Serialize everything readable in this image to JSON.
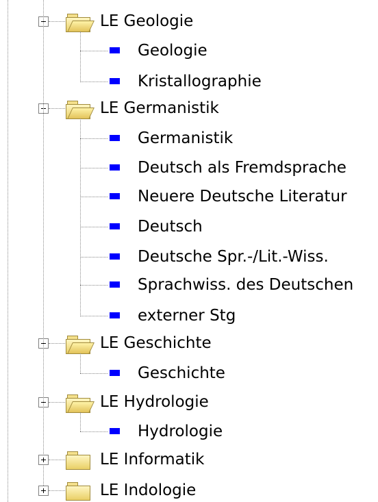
{
  "tree": {
    "nodes": [
      {
        "label": "LE Geologie",
        "expanded": true,
        "icon": "folder-open-icon",
        "children": [
          "Geologie",
          "Kristallographie"
        ]
      },
      {
        "label": "LE Germanistik",
        "expanded": true,
        "icon": "folder-open-icon",
        "children": [
          "Germanistik",
          "Deutsch als Fremdsprache",
          "Neuere Deutsche Literatur",
          "Deutsch",
          "Deutsche Spr.-/Lit.-Wiss.",
          "Sprachwiss. des Deutschen",
          "externer Stg"
        ]
      },
      {
        "label": "LE Geschichte",
        "expanded": true,
        "icon": "folder-open-icon",
        "children": [
          "Geschichte"
        ]
      },
      {
        "label": "LE Hydrologie",
        "expanded": true,
        "icon": "folder-open-icon",
        "children": [
          "Hydrologie"
        ]
      },
      {
        "label": "LE Informatik",
        "expanded": false,
        "icon": "folder-closed-icon",
        "children": []
      },
      {
        "label": "LE Indologie",
        "expanded": false,
        "icon": "folder-closed-icon",
        "children": []
      }
    ],
    "leaf_icon": "blue-square-icon",
    "leaf_color": "#0000ff",
    "folder_color": "#f2d870",
    "line_color": "#8a8a8a"
  }
}
